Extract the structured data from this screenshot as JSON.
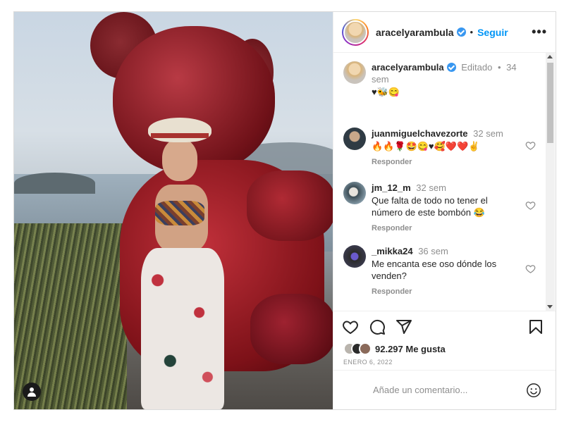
{
  "header": {
    "username": "aracelyarambula",
    "separator": "•",
    "follow_label": "Seguir",
    "more_label": "•••"
  },
  "caption": {
    "username": "aracelyarambula",
    "edited": "Editado",
    "separator": "•",
    "time": "34 sem",
    "text": "♥🐝😋"
  },
  "comments": [
    {
      "username": "juanmiguelchavezorte",
      "time": "32 sem",
      "text": "🔥🔥🌹🤩😋♥🥰❤️❤️✌️",
      "reply_label": "Responder"
    },
    {
      "username": "jm_12_m",
      "time": "32 sem",
      "text": "Que falta de todo no tener el número de este bombón 😂",
      "reply_label": "Responder"
    },
    {
      "username": "_mikka24",
      "time": "36 sem",
      "text": "Me encanta ese oso dónde los venden?",
      "reply_label": "Responder"
    }
  ],
  "likes": {
    "count": "92.297",
    "label": "Me gusta"
  },
  "date": "ENERO 6, 2022",
  "comment_input": {
    "placeholder": "Añade un comentario..."
  },
  "colors": {
    "verified": "#3897f0",
    "follow": "#0095f6",
    "secondary_text": "#8e8e8e",
    "primary_text": "#262626"
  }
}
